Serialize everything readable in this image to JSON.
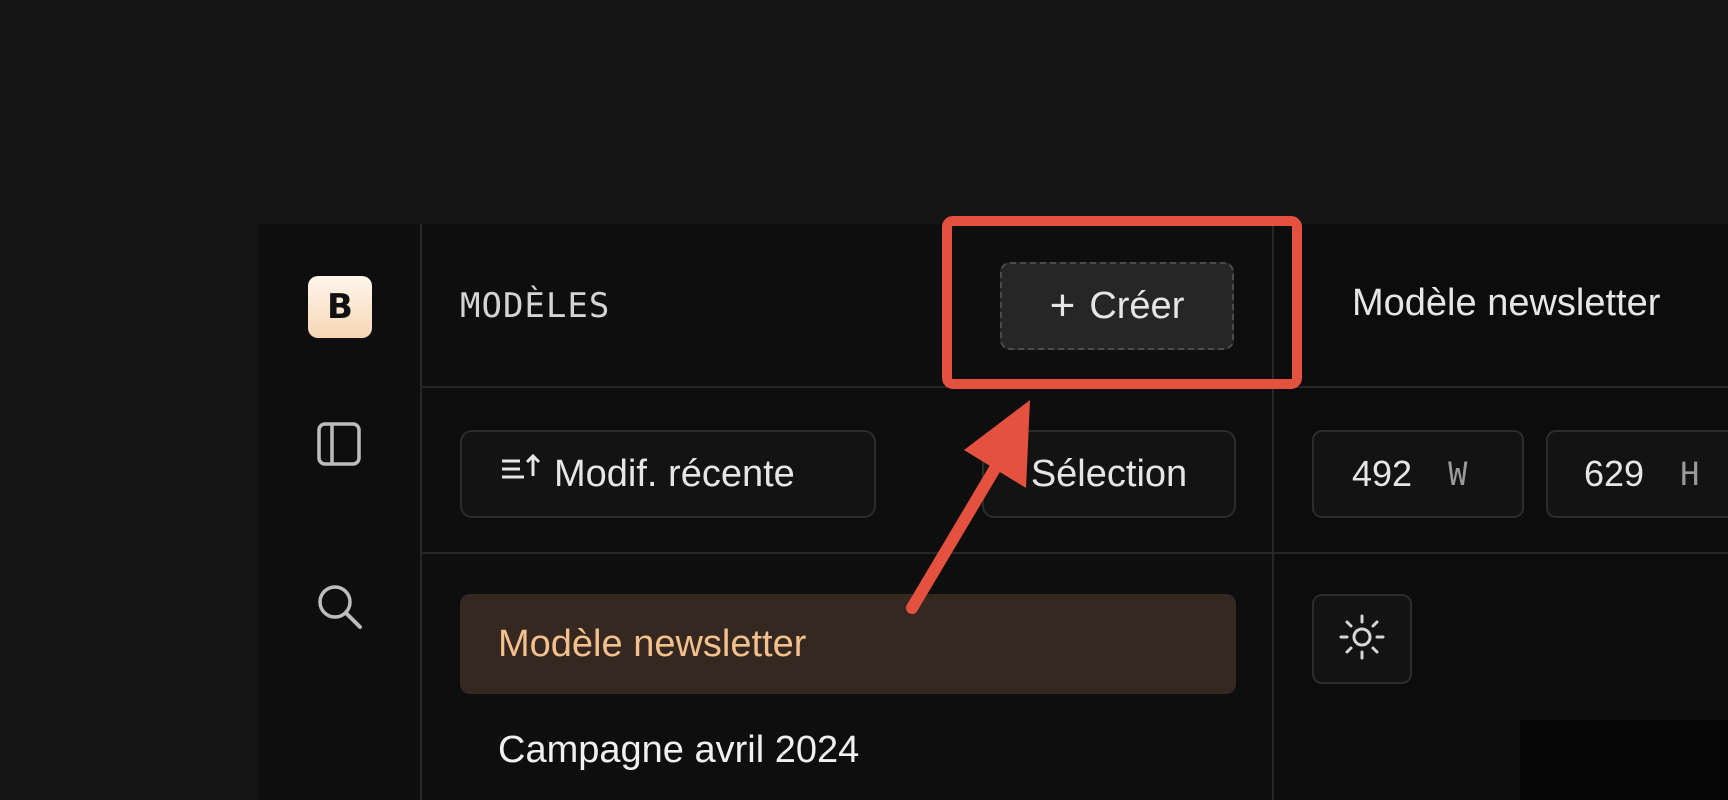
{
  "rail": {
    "logo_letter": "B",
    "icons": [
      "sidebar-panel-icon",
      "search-icon"
    ]
  },
  "panel": {
    "title": "MODÈLES",
    "create_button": {
      "icon": "plus-icon",
      "label": "Créer"
    },
    "sort_button": {
      "icon": "sort-ascending-icon",
      "label": "Modif. récente"
    },
    "select_button": {
      "label": "Sélection"
    },
    "items": [
      {
        "label": "Modèle newsletter",
        "active": true
      },
      {
        "label": "Campagne avril 2024",
        "active": false
      }
    ]
  },
  "main": {
    "title": "Modèle newsletter",
    "width": {
      "value": "492",
      "unit": "W"
    },
    "height": {
      "value": "629",
      "unit": "H"
    },
    "theme_toggle_icon": "sun-icon"
  },
  "colors": {
    "annotation": "#e5513f",
    "active_item_bg": "#352820",
    "active_item_text": "#f3c08e",
    "logo_gradient": [
      "#fff6ec",
      "#f7d6b5"
    ]
  }
}
